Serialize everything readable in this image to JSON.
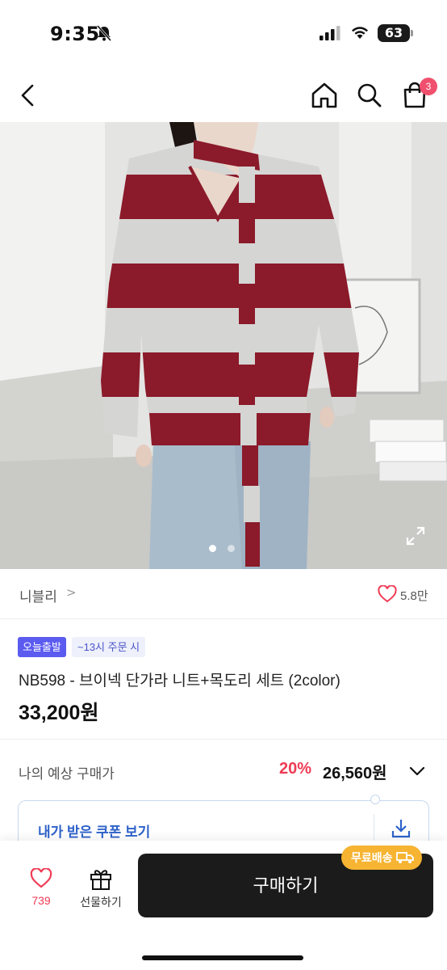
{
  "status_bar": {
    "time": "9:35",
    "battery": "63"
  },
  "nav": {
    "cart_count": "3"
  },
  "gallery": {
    "slide_count": 2,
    "active_slide": 1
  },
  "shop": {
    "name": "니블리",
    "chevron": ">",
    "like_count": "5.8만"
  },
  "product": {
    "badge_today": "오늘출발",
    "badge_cutoff": "~13시 주문 시",
    "title": "NB598 - 브이넥 단가라 니트+목도리 세트 (2color)",
    "price": "33,200원"
  },
  "estimate": {
    "label": "나의 예상 구매가",
    "discount": "20%",
    "price": "26,560원"
  },
  "coupon": {
    "label": "내가 받은 쿠폰 보기"
  },
  "bottom_bar": {
    "wish_count": "739",
    "gift_label": "선물하기",
    "buy_label": "구매하기",
    "shipping_badge": "무료배송"
  },
  "colors": {
    "accent_red": "#ef3b55",
    "today_badge": "#5b5bf0",
    "shipping_badge": "#f6b432",
    "buy_button": "#1b1b1b",
    "coupon_text": "#2e62c9"
  },
  "icons": [
    "back-icon",
    "home-icon",
    "search-icon",
    "cart-icon",
    "expand-icon",
    "heart-icon",
    "gift-icon",
    "download-icon",
    "chevron-down-icon",
    "truck-icon"
  ]
}
